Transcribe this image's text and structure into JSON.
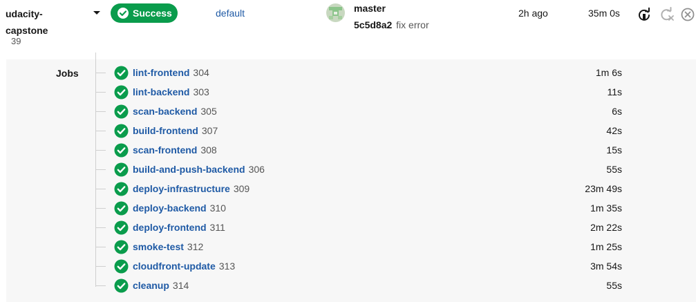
{
  "pipeline": {
    "project_line1": "udacity-",
    "project_line2": "capstone",
    "number": "39",
    "status_label": "Success",
    "workflow": "default",
    "branch": "master",
    "commit_hash": "5c5d8a2",
    "commit_message": "fix error",
    "time_ago": "2h ago",
    "duration": "35m 0s",
    "actions": [
      "rerun-icon",
      "rerun-failed-icon",
      "cancel-icon"
    ]
  },
  "jobs_label": "Jobs",
  "colors": {
    "success": "#0a9c4c",
    "link": "#1f5aa5",
    "panel": "#f7f7f7"
  },
  "jobs": [
    {
      "name": "lint-frontend",
      "number": "304",
      "duration": "1m 6s"
    },
    {
      "name": "lint-backend",
      "number": "303",
      "duration": "11s"
    },
    {
      "name": "scan-backend",
      "number": "305",
      "duration": "6s"
    },
    {
      "name": "build-frontend",
      "number": "307",
      "duration": "42s"
    },
    {
      "name": "scan-frontend",
      "number": "308",
      "duration": "15s"
    },
    {
      "name": "build-and-push-backend",
      "number": "306",
      "duration": "55s"
    },
    {
      "name": "deploy-infrastructure",
      "number": "309",
      "duration": "23m 49s"
    },
    {
      "name": "deploy-backend",
      "number": "310",
      "duration": "1m 35s"
    },
    {
      "name": "deploy-frontend",
      "number": "311",
      "duration": "2m 22s"
    },
    {
      "name": "smoke-test",
      "number": "312",
      "duration": "1m 25s"
    },
    {
      "name": "cloudfront-update",
      "number": "313",
      "duration": "3m 54s"
    },
    {
      "name": "cleanup",
      "number": "314",
      "duration": "55s"
    }
  ]
}
